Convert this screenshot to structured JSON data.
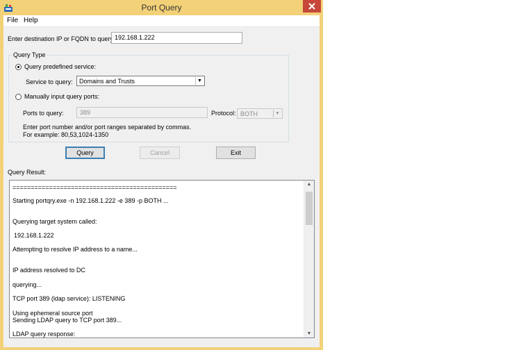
{
  "window": {
    "title": "Port Query"
  },
  "menu": {
    "file": "File",
    "help": "Help"
  },
  "destination": {
    "label": "Enter destination IP or FQDN to query:",
    "value": "192.168.1.222"
  },
  "query_type": {
    "legend": "Query Type",
    "predefined_label": "Query predefined service:",
    "service_label": "Service to query:",
    "service_value": "Domains and Trusts",
    "manual_label": "Manually input query ports:",
    "ports_label": "Ports to query:",
    "ports_value": "389",
    "protocol_label": "Protocol:",
    "protocol_value": "BOTH",
    "hint1": "Enter port number and/or port ranges separated by commas.",
    "hint2": "For example: 80,53,1024-1350"
  },
  "buttons": {
    "query": "Query",
    "cancel": "Cancel",
    "exit": "Exit"
  },
  "result": {
    "label": "Query Result:",
    "lines": [
      "=============================================",
      "Starting portqry.exe -n 192.168.1.222 -e 389 -p BOTH ...",
      "Querying target system called:",
      "192.168.1.222",
      "Attempting to resolve IP address to a name...",
      "IP address resolved to DC",
      "querying...",
      "TCP port 389 (ldap service): LISTENING",
      "Using ephemeral source port",
      "Sending LDAP query to TCP port 389...",
      "LDAP query response:"
    ]
  },
  "colors": {
    "frame": "#f3d178",
    "close": "#c7473b",
    "default_border": "#3c7fb1"
  },
  "icons": {
    "app": "app-icon",
    "close": "close-icon",
    "scroll_up": "scroll-up-icon",
    "scroll_down": "scroll-down-icon",
    "dropdown": "chevron-down-icon"
  }
}
